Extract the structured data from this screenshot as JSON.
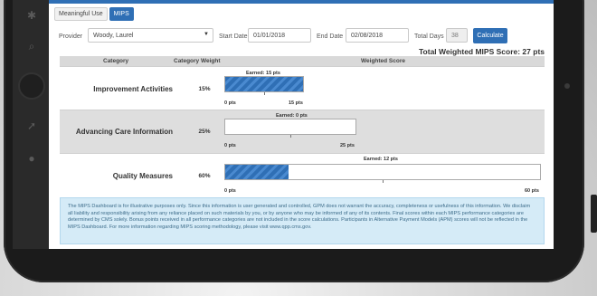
{
  "tabs": [
    {
      "label": "Meaningful Use"
    },
    {
      "label": "MIPS"
    }
  ],
  "filters": {
    "provider_label": "Provider",
    "provider_value": "Woody, Laurel",
    "start_date_label": "Start Date",
    "start_date_value": "01/01/2018",
    "end_date_label": "End Date",
    "end_date_value": "02/08/2018",
    "total_days_label": "Total Days",
    "total_days_value": "38",
    "calculate_label": "Calculate"
  },
  "total_score": "Total Weighted MIPS Score: 27 pts",
  "table": {
    "headers": [
      "Category",
      "Category Weight",
      "Weighted Score"
    ],
    "rows": [
      {
        "category": "Improvement Activities",
        "weight": "15%",
        "earned_label": "Earned: 15 pts",
        "earned": 15,
        "max": 15,
        "min_label": "0 pts",
        "max_label": "15 pts"
      },
      {
        "category": "Advancing Care Information",
        "weight": "25%",
        "earned_label": "Earned: 0 pts",
        "earned": 0,
        "max": 25,
        "min_label": "0 pts",
        "max_label": "25 pts"
      },
      {
        "category": "Quality Measures",
        "weight": "60%",
        "earned_label": "Earned: 12 pts",
        "earned": 12,
        "max": 60,
        "min_label": "0 pts",
        "max_label": "60 pts"
      }
    ]
  },
  "disclaimer": "The MIPS Dashboard is for illustrative purposes only. Since this information is user generated and controlled, GPM does not warrant the accuracy, completeness or usefulness of this information. We disclaim all liability and responsibility arising from any reliance placed on such materials by you, or by anyone who may be informed of any of its contents. Final scores within each MIPS performance categories are determined by CMS solely. Bonus points received in all performance categories are not included in the score calculations. Participants in Alternative Payment Models (APM) scores will not be reflected in the MIPS Dashboard. For more information regarding MIPS scoring methodology, please visit www.qpp.cms.gov.",
  "colors": {
    "accent": "#2f6fb5",
    "row_alt": "#dedede",
    "disclaimer_bg": "#d5ebf7"
  }
}
